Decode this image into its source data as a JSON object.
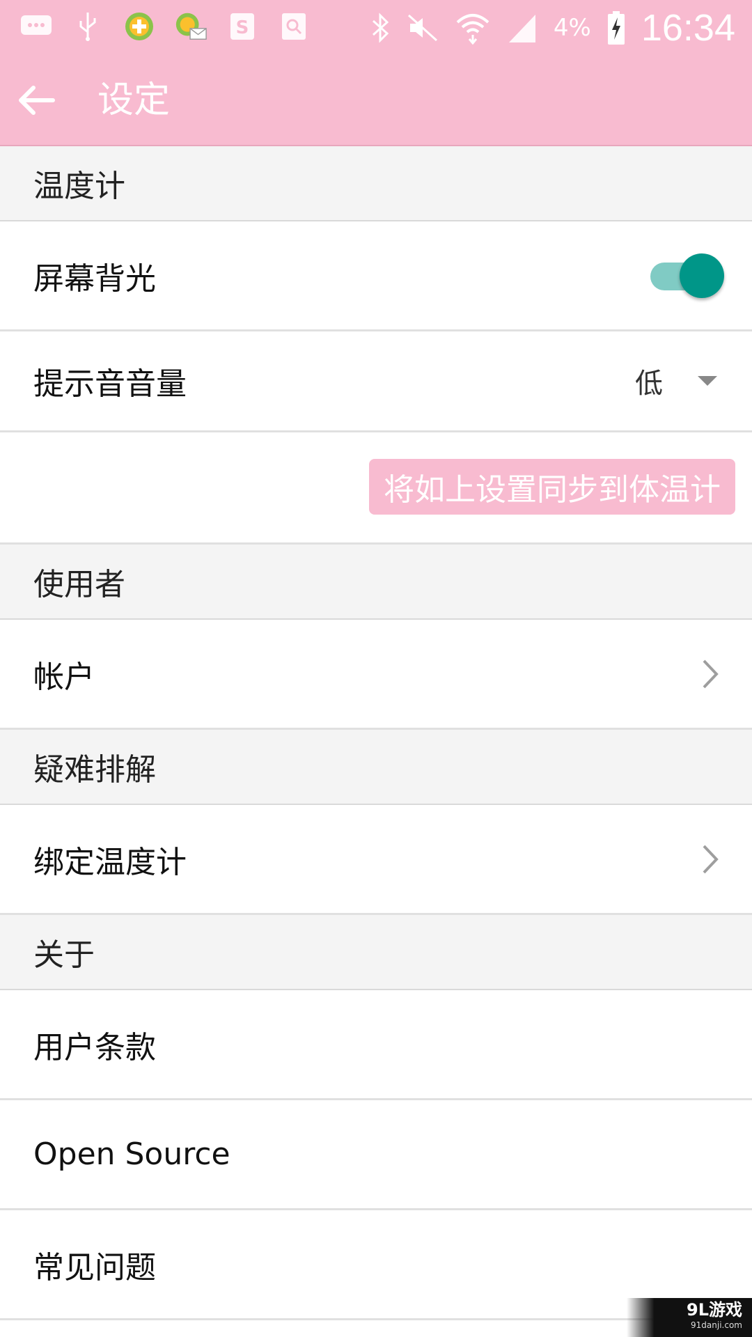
{
  "status_bar": {
    "icons_left": [
      "chat-notification-icon",
      "usb-icon",
      "app-360-icon",
      "app-360-mail-icon",
      "s-app-icon",
      "search-app-icon"
    ],
    "icons_right": [
      "bluetooth-icon",
      "mute-icon",
      "wifi-icon",
      "signal-icon",
      "battery-charging-icon"
    ],
    "battery_text": "4%",
    "time": "16:34"
  },
  "appbar": {
    "title": "设定"
  },
  "thermometer": {
    "section_title": "温度计",
    "backlight_label": "屏幕背光",
    "backlight_on": true,
    "volume_label": "提示音音量",
    "volume_value": "低",
    "sync_button": "将如上设置同步到体温计"
  },
  "user": {
    "section_title": "使用者",
    "account_label": "帐户"
  },
  "troubleshoot": {
    "section_title": "疑难排解",
    "bind_label": "绑定温度计"
  },
  "about": {
    "section_title": "关于",
    "terms_label": "用户条款",
    "open_source_label": "Open Source",
    "faq_label": "常见问题"
  },
  "watermark": {
    "main": "9L游戏",
    "sub": "91danji.com"
  },
  "colors": {
    "accent_pink": "#f8bbd0",
    "toggle_teal": "#009688"
  }
}
